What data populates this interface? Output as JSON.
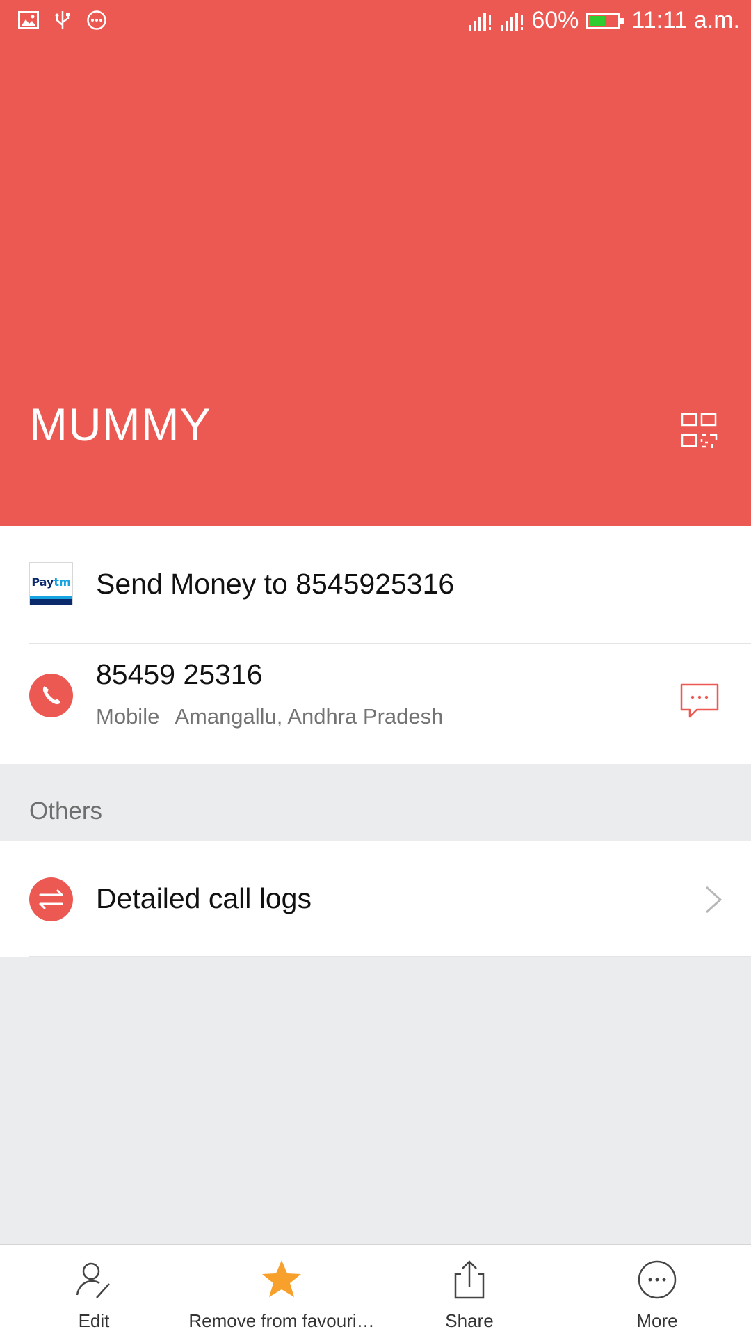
{
  "status_bar": {
    "battery_percent": "60%",
    "battery_level": 0.6,
    "time": "11:11 a.m.",
    "icons": [
      "image-icon",
      "usb-icon",
      "more-notifications-icon",
      "signal-icon",
      "signal-icon"
    ]
  },
  "contact": {
    "name": "MUMMY"
  },
  "paytm": {
    "label": "Send Money to 8545925316"
  },
  "phone": {
    "number": "85459 25316",
    "type": "Mobile",
    "location": "Amangallu, Andhra Pradesh"
  },
  "others": {
    "section_title": "Others",
    "call_logs_label": "Detailed call logs"
  },
  "bottom_bar": {
    "edit_label": "Edit",
    "favourite_label": "Remove from favouri…",
    "share_label": "Share",
    "more_label": "More"
  },
  "colors": {
    "accent": "#ec5953",
    "star": "#f7a12c",
    "background": "#ebeced"
  }
}
